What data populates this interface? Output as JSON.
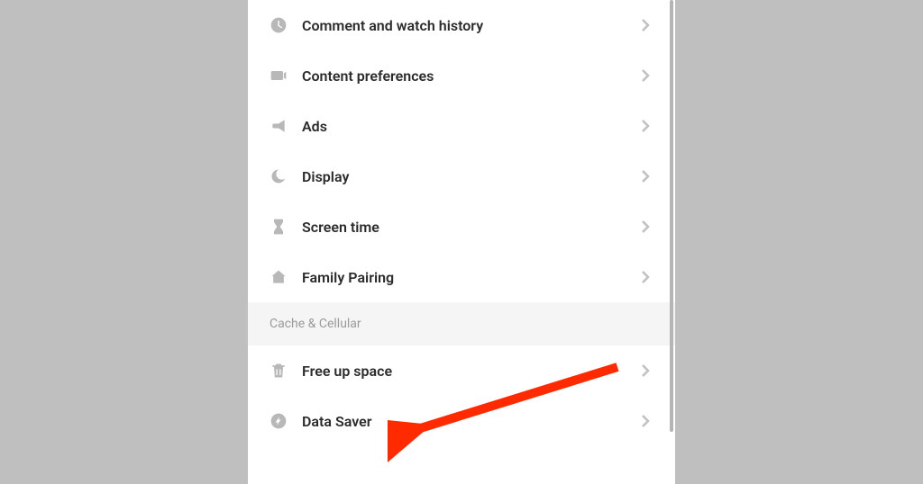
{
  "settings": {
    "items_top": [
      {
        "icon": "clock",
        "label": "Comment and watch history",
        "name": "comment-history"
      },
      {
        "icon": "video",
        "label": "Content preferences",
        "name": "content-preferences"
      },
      {
        "icon": "megaphone",
        "label": "Ads",
        "name": "ads"
      },
      {
        "icon": "moon",
        "label": "Display",
        "name": "display"
      },
      {
        "icon": "hourglass",
        "label": "Screen time",
        "name": "screen-time"
      },
      {
        "icon": "home",
        "label": "Family Pairing",
        "name": "family-pairing"
      }
    ],
    "section_header": "Cache & Cellular",
    "items_bottom": [
      {
        "icon": "trash",
        "label": "Free up space",
        "name": "free-up-space"
      },
      {
        "icon": "bolt",
        "label": "Data Saver",
        "name": "data-saver"
      }
    ]
  }
}
